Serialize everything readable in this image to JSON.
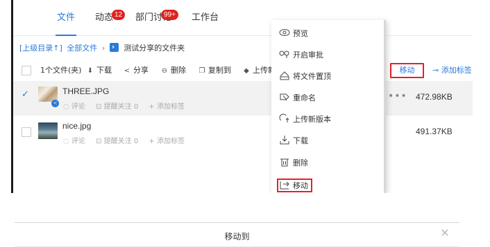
{
  "tabs": [
    {
      "label": "文件",
      "active": true
    },
    {
      "label": "动态",
      "badge": "12"
    },
    {
      "label": "部门讨论",
      "badge": "99+"
    },
    {
      "label": "工作台"
    }
  ],
  "breadcrumb": {
    "parent": "[上级目录↑]",
    "root": "全部文件",
    "separator": "›",
    "current": "测试分享的文件夹"
  },
  "toolbar": {
    "count_label": "1个文件(夹)",
    "download": "下载",
    "share": "分享",
    "delete": "删除",
    "copy_to": "复制到",
    "upload": "上传新",
    "move": "移动",
    "add_tag": "添加标签"
  },
  "files": [
    {
      "name": "THREE.JPG",
      "comment": "评论",
      "remind": "提醒关注 0",
      "add_tag": "+ 添加标签",
      "size": "472.98KB",
      "selected": true
    },
    {
      "name": "nice.jpg",
      "comment": "评论",
      "remind": "提醒关注 0",
      "add_tag": "+ 添加标签",
      "size": "491.37KB",
      "selected": false
    }
  ],
  "context_menu": [
    {
      "label": "预览",
      "icon": "eye-icon"
    },
    {
      "label": "开启审批",
      "icon": "approval-icon"
    },
    {
      "label": "将文件置顶",
      "icon": "pin-top-icon"
    },
    {
      "label": "重命名",
      "icon": "rename-icon"
    },
    {
      "label": "上传新版本",
      "icon": "upload-version-icon"
    },
    {
      "label": "下载",
      "icon": "download-icon"
    },
    {
      "label": "删除",
      "icon": "trash-icon"
    },
    {
      "label": "移动",
      "icon": "move-icon",
      "highlighted": true
    }
  ],
  "dialog": {
    "title": "移动到",
    "close": "✕"
  },
  "colors": {
    "accent": "#2b79d9",
    "badge": "#e0221e",
    "highlight_border": "#e2212b",
    "selected_row": "#f2f2f2"
  }
}
